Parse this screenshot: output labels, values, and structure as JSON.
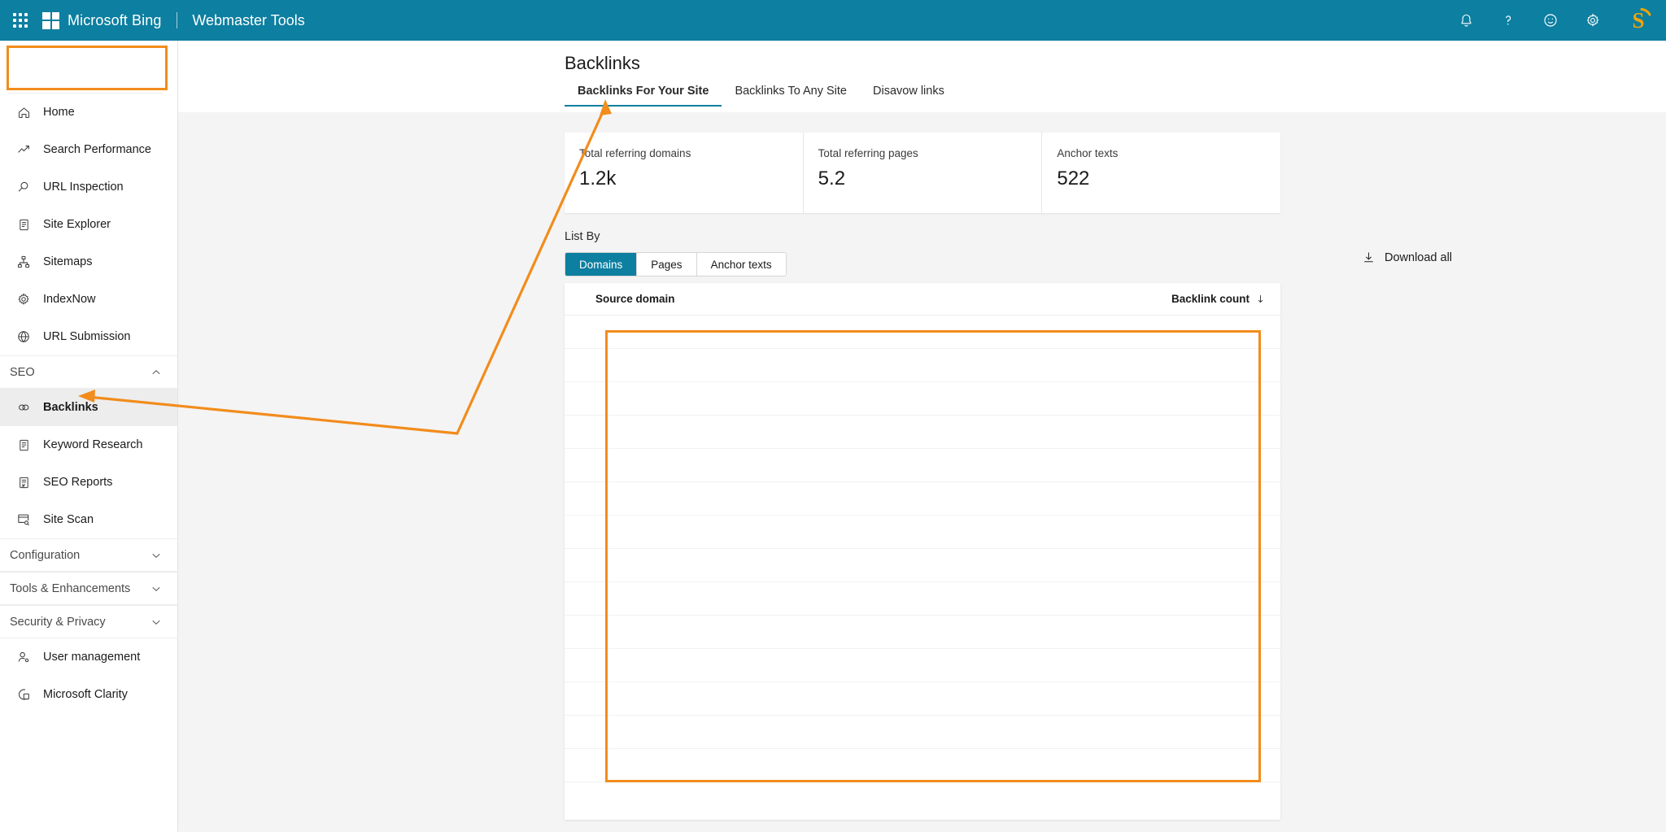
{
  "topbar": {
    "waffle_icon": "app-launcher-icon",
    "brand": "Microsoft Bing",
    "product": "Webmaster Tools",
    "icons": [
      {
        "name": "notifications-icon",
        "glyph": "bell"
      },
      {
        "name": "help-icon",
        "glyph": "question"
      },
      {
        "name": "feedback-icon",
        "glyph": "smiley"
      },
      {
        "name": "settings-icon",
        "glyph": "gear"
      }
    ],
    "avatar_letter": "S"
  },
  "sidebar": {
    "site_selector_value": "",
    "items": [
      {
        "label": "Home",
        "icon": "home-icon"
      },
      {
        "label": "Search Performance",
        "icon": "trending-up-icon"
      },
      {
        "label": "URL Inspection",
        "icon": "magnifier-icon"
      },
      {
        "label": "Site Explorer",
        "icon": "document-list-icon"
      },
      {
        "label": "Sitemaps",
        "icon": "sitemap-icon"
      },
      {
        "label": "IndexNow",
        "icon": "gear-icon"
      },
      {
        "label": "URL Submission",
        "icon": "globe-icon"
      }
    ],
    "seo_group": {
      "label": "SEO",
      "expanded": true,
      "chevron": "chevron-up-icon"
    },
    "seo_items": [
      {
        "label": "Backlinks",
        "icon": "links-icon",
        "selected": true
      },
      {
        "label": "Keyword Research",
        "icon": "document-list-icon",
        "selected": false
      },
      {
        "label": "SEO Reports",
        "icon": "report-icon",
        "selected": false
      },
      {
        "label": "Site Scan",
        "icon": "scan-icon",
        "selected": false
      }
    ],
    "collapsed_groups": [
      {
        "label": "Configuration",
        "chevron": "chevron-down-icon"
      },
      {
        "label": "Tools & Enhancements",
        "chevron": "chevron-down-icon"
      },
      {
        "label": "Security & Privacy",
        "chevron": "chevron-down-icon"
      }
    ],
    "bottom_items": [
      {
        "label": "User management",
        "icon": "person-icon"
      },
      {
        "label": "Microsoft Clarity",
        "icon": "clarity-icon"
      }
    ]
  },
  "main": {
    "page_title": "Backlinks",
    "tabs": [
      {
        "label": "Backlinks For Your Site",
        "active": true
      },
      {
        "label": "Backlinks To Any Site",
        "active": false
      },
      {
        "label": "Disavow links",
        "active": false
      }
    ],
    "stats": [
      {
        "label": "Total referring domains",
        "value": "1.2k"
      },
      {
        "label": "Total referring pages",
        "value": "5.2"
      },
      {
        "label": "Anchor texts",
        "value": "522"
      }
    ],
    "list_by_label": "List By",
    "segments": [
      {
        "label": "Domains",
        "active": true
      },
      {
        "label": "Pages",
        "active": false
      },
      {
        "label": "Anchor texts",
        "active": false
      }
    ],
    "download_label": "Download all",
    "download_icon": "download-icon",
    "table": {
      "columns": [
        {
          "label": "Source domain",
          "align": "left"
        },
        {
          "label": "Backlink count",
          "align": "right",
          "sort_icon": "sort-descending-icon"
        }
      ],
      "rows": [
        {
          "source_domain": "",
          "backlink_count": ""
        },
        {
          "source_domain": "",
          "backlink_count": ""
        },
        {
          "source_domain": "",
          "backlink_count": ""
        },
        {
          "source_domain": "",
          "backlink_count": ""
        },
        {
          "source_domain": "",
          "backlink_count": ""
        },
        {
          "source_domain": "",
          "backlink_count": ""
        },
        {
          "source_domain": "",
          "backlink_count": ""
        },
        {
          "source_domain": "",
          "backlink_count": ""
        },
        {
          "source_domain": "",
          "backlink_count": ""
        },
        {
          "source_domain": "",
          "backlink_count": ""
        },
        {
          "source_domain": "",
          "backlink_count": ""
        },
        {
          "source_domain": "",
          "backlink_count": ""
        },
        {
          "source_domain": "",
          "backlink_count": ""
        },
        {
          "source_domain": "",
          "backlink_count": ""
        },
        {
          "source_domain": "",
          "backlink_count": ""
        }
      ]
    }
  },
  "annotations": {
    "highlight_color": "#f28c1c",
    "boxes": [
      {
        "name": "site-selector-highlight"
      },
      {
        "name": "table-rows-highlight"
      }
    ],
    "arrows": [
      {
        "name": "arrow-to-backlinks-tab"
      },
      {
        "name": "arrow-to-sidebar-backlinks"
      }
    ]
  },
  "colors": {
    "brand_teal": "#0d7fa0",
    "accent_orange": "#f28c1c",
    "page_bg": "#f4f4f4",
    "card_bg": "#ffffff"
  }
}
